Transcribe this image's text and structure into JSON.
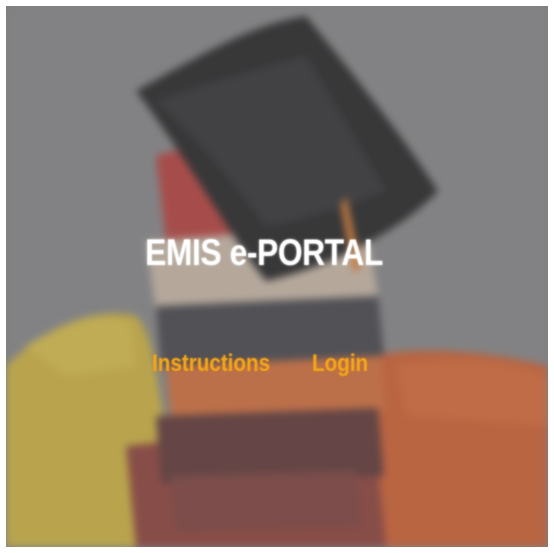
{
  "portal": {
    "title": "EMIS e-PORTAL",
    "background_image": "graduation-cap-on-books-over-map",
    "accent_color": "#f2a51c"
  },
  "nav": {
    "instructions_label": "Instructions",
    "login_label": "Login"
  }
}
